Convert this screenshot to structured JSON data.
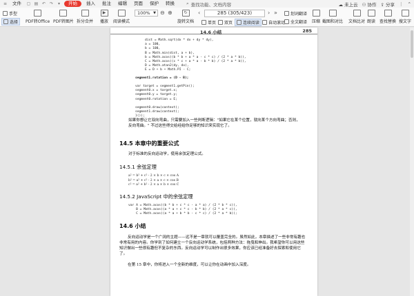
{
  "menu": {
    "file": "文件",
    "items": [
      "开始",
      "插入",
      "批注",
      "编辑",
      "页面",
      "保护",
      "转换"
    ],
    "active_index": 0,
    "search": "查找功能、文档内容",
    "right": {
      "cloud": "未上云",
      "collab": "协作",
      "share": "分享"
    }
  },
  "toolbar": {
    "hand": "手型",
    "select": "选择",
    "pdf_office": "PDF转Office",
    "pdf_image": "PDF转图片",
    "split_merge": "拆分合并",
    "play": "播放",
    "read_mode": "阅读模式",
    "zoom": "100%",
    "rotate": "旋转文档",
    "single_page": "单页",
    "double_page": "双页",
    "continuous": "连续阅读",
    "auto_scroll": "自动滚动",
    "page_indicator": "285 (305/423)",
    "word_translate": "划词翻译",
    "full_translate": "全文翻译",
    "compress": "压缩",
    "screenshot_compare": "截图和对比",
    "text_compare": "文档比对",
    "annotate": "朗读",
    "find_replace": "查找替换",
    "search_text": "搜文字"
  },
  "page": {
    "header_title": "14.6 小结",
    "header_number": "285",
    "code1": "dist = Math.sqrt(dx * dx + dy * dy),\na = 100,\nb = 100,\nB = Math.min(dist, a + b),\nb = Math.acos((b * b + a * a - c * c) / (2 * a * b)),\nC = Math.acos((c * c + a * a - b * b) / (2 * a * b)),\nD = Math.atan2(dy, dx),\nE = D + b + Math.PI - C;",
    "code2": "segment1.rotation = (D - B);",
    "code3": "var target = segment1.getPin();\nsegment0.x = target.x;\nsegment0.y = target.y;\nsegment0.rotation = E;",
    "code4": "segment0.draw(context);\nsegment1.draw(context);\n}());",
    "para1": "如果你想让它双向弯曲，只需要加入一些判断逻辑：\"如果它在某个位置，就向某个方向弯曲；否则，反向弯曲。\" 不过这些得交给经给你足够的知识来实现它了。",
    "h_14_5": "14.5  本章中的重要公式",
    "para2": "对于标准的反向运动学，使用余弦定理公式。",
    "h_14_5_1": "14.5.1  余弦定理",
    "formulas": "a² = b² + c² - 2 × b × c × cos A\nb² = a² + c² - 2 × a × c × cos B\nc² = a² + b² - 2 × a × b × cos C",
    "h_14_5_2": "14.5.2  JavaScript 中的余弦定理",
    "code5": "var A = Math.acos((b * b + c * c - a * a) / (2 * b * c)),\n    B = Math.acos((a * a + c * c - b * b) / (2 * a * c)),\n    C = Math.acos((a * a + b * b - c * c) / (2 * a * b));",
    "h_14_6": "14.6  小结",
    "para3": "反向运动学是一个广阔的主题——远不是一章就可以覆盖完全的。虽然如此，本章描述了一些非常有趣也非常有用的内容。你学到了如何建立一个反向运动学系统，包括两种方法：拖曳和伸出。我希望你可以用这些知识做出一些很有趣但不复杂的东西。反向运动学可以制作出很多效果，你应该已经准备好去探索和使用它了。",
    "para4": "在第 15 章中，你将进入一个全新的维度，可以让你在动画中加入深度。"
  }
}
